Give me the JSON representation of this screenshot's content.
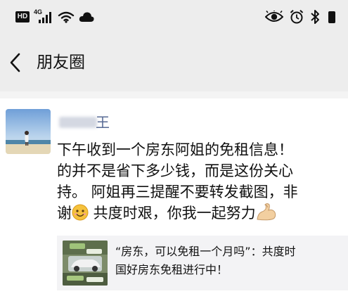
{
  "status_bar": {
    "hd_label": "HD",
    "network_label": "4G"
  },
  "header": {
    "title": "朋友圈"
  },
  "post": {
    "author_visible": "王",
    "lines": [
      "下午收到一个房东阿姐的免租信息！",
      "的并不是省下多少钱，而是这份关心",
      "持。 阿姐再三提醒不要转发截图，非"
    ],
    "line4_prefix": "谢",
    "line4_suffix": " 共度时艰，你我一起努力",
    "link": {
      "title_line1": "“房东，可以免租一个月吗”：共度时",
      "title_line2": "国好房东免租进行中！"
    }
  },
  "colors": {
    "bar_bg": "#ededed",
    "link_name": "#586b95",
    "link_card_bg": "#f3f3f5"
  },
  "icons": [
    "back-arrow-icon",
    "eye-icon",
    "alarm-icon",
    "bluetooth-icon",
    "wifi-icon",
    "cloud-icon",
    "signal-icon",
    "smile-emoji-icon",
    "flexed-biceps-emoji-icon"
  ]
}
